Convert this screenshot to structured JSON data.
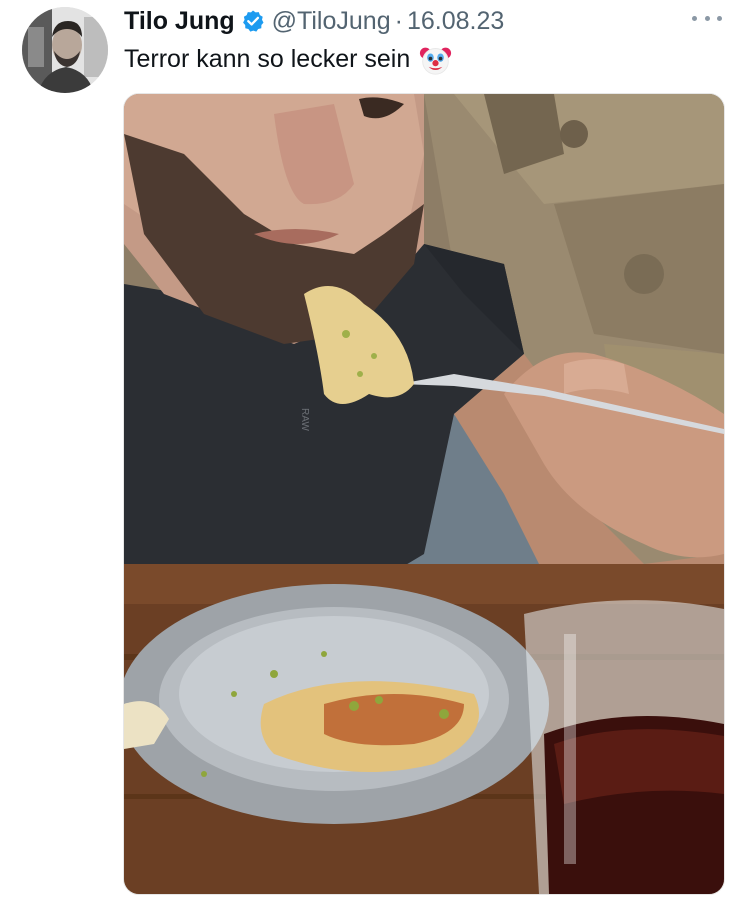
{
  "tweet": {
    "author_name": "Tilo Jung",
    "handle": "@TiloJung",
    "separator": "·",
    "date": "16.08.23",
    "text": "Terror kann so lecker sein",
    "emoji": "clown-face-emoji",
    "verified": true,
    "more_icon": "more-horizontal-icon"
  },
  "colors": {
    "verified_blue": "#1d9bf0",
    "text_primary": "#0f1419",
    "text_secondary": "#536471"
  },
  "media": {
    "type": "photo",
    "shirt_logo_text": "RAW"
  }
}
